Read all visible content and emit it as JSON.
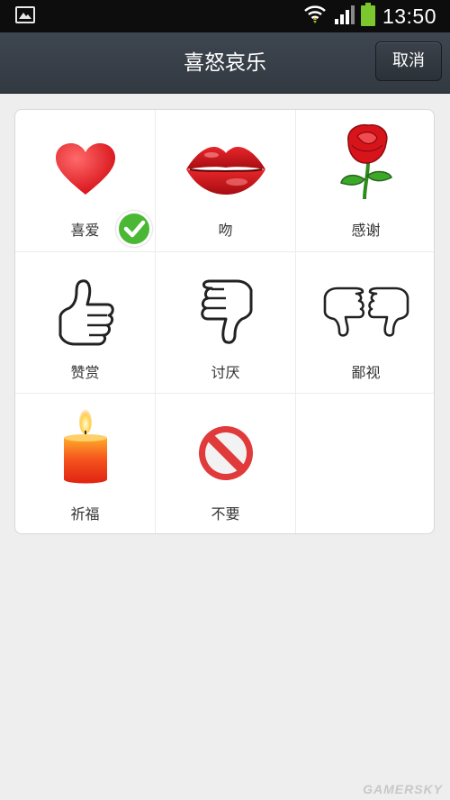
{
  "statusbar": {
    "time": "13:50",
    "icons": [
      "gallery-icon",
      "wifi-icon",
      "signal-icon",
      "battery-icon"
    ]
  },
  "header": {
    "title": "喜怒哀乐",
    "cancel_label": "取消"
  },
  "reactions": [
    {
      "label": "喜爱",
      "icon": "heart-icon",
      "selected": true
    },
    {
      "label": "吻",
      "icon": "lips-icon",
      "selected": false
    },
    {
      "label": "感谢",
      "icon": "rose-icon",
      "selected": false
    },
    {
      "label": "赞赏",
      "icon": "thumbs-up-icon",
      "selected": false
    },
    {
      "label": "讨厌",
      "icon": "thumbs-down-icon",
      "selected": false
    },
    {
      "label": "鄙视",
      "icon": "double-thumbs-down-icon",
      "selected": false
    },
    {
      "label": "祈福",
      "icon": "candle-icon",
      "selected": false
    },
    {
      "label": "不要",
      "icon": "prohibited-icon",
      "selected": false
    }
  ],
  "colors": {
    "header": "#353c44",
    "heart": "#e8232a",
    "selected_check": "#4ab835"
  },
  "watermark": "GAMERSKY"
}
